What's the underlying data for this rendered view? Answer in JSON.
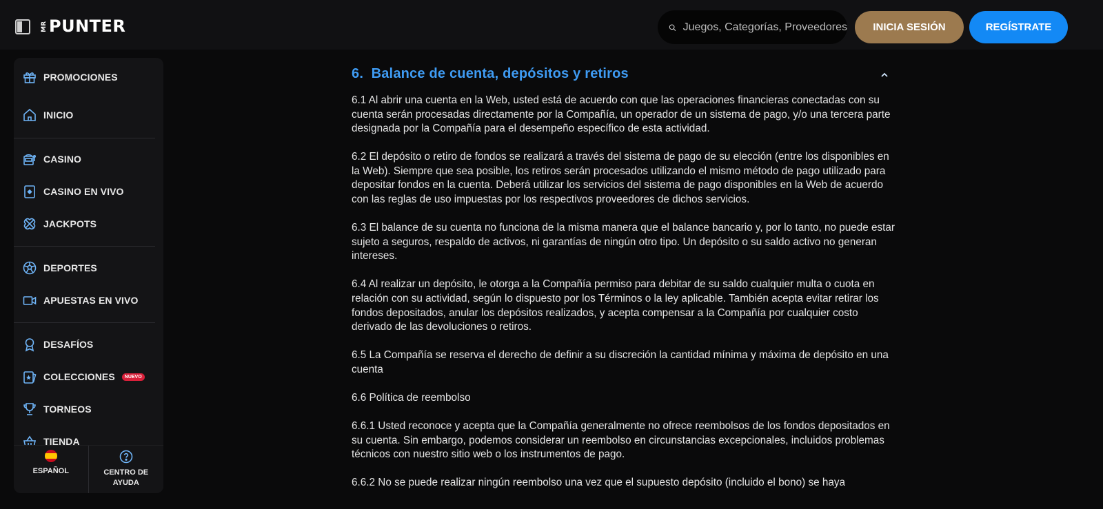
{
  "header": {
    "logo_small": "MR",
    "logo_word": "PUNTER",
    "search_placeholder": "Juegos, Categorías, Proveedores",
    "login_label": "INICIA SESIÓN",
    "register_label": "REGÍSTRATE"
  },
  "sidebar": {
    "items": [
      {
        "label": "PROMOCIONES",
        "icon": "gift-icon"
      },
      {
        "label": "INICIO",
        "icon": "home-icon"
      },
      {
        "label": "CASINO",
        "icon": "slot-machine-icon"
      },
      {
        "label": "CASINO EN VIVO",
        "icon": "card-icon"
      },
      {
        "label": "JACKPOTS",
        "icon": "clover-icon"
      },
      {
        "label": "DEPORTES",
        "icon": "soccer-ball-icon"
      },
      {
        "label": "APUESTAS EN VIVO",
        "icon": "video-camera-icon"
      },
      {
        "label": "DESAFÍOS",
        "icon": "medal-icon"
      },
      {
        "label": "COLECCIONES",
        "icon": "star-card-icon",
        "badge": "NUEVO"
      },
      {
        "label": "TORNEOS",
        "icon": "trophy-icon"
      },
      {
        "label": "TIENDA",
        "icon": "shop-basket-icon"
      }
    ],
    "bottom": {
      "language_label": "ESPAÑOL",
      "help_line1": "CENTRO DE",
      "help_line2": "AYUDA"
    }
  },
  "main": {
    "section_title": "6.  Balance de cuenta, depósitos y retiros",
    "paragraphs": [
      "6.1 Al abrir una cuenta en la Web, usted está de acuerdo con que las operaciones financieras conectadas con su cuenta serán procesadas directamente por la Compañía, un operador de un sistema de pago, y/o una tercera parte designada por la Compañía para el desempeño específico de esta actividad.",
      "6.2 El depósito o retiro de fondos se realizará a través del sistema de pago de su elección (entre los disponibles en la Web). Siempre que sea posible, los retiros serán procesados utilizando el mismo método de pago utilizado para depositar fondos en la cuenta. Deberá utilizar los servicios del sistema de pago disponibles en la Web de acuerdo con las reglas de uso impuestas por los respectivos proveedores de dichos servicios.",
      "6.3 El balance de su cuenta no funciona de la misma manera que el balance bancario y, por lo tanto, no puede estar sujeto a seguros, respaldo de activos, ni garantías de ningún otro tipo. Un depósito o su saldo activo no generan intereses.",
      "6.4 Al realizar un depósito, le otorga a la Compañía permiso para debitar de su saldo cualquier multa o cuota en relación con su actividad, según lo dispuesto por los Términos o la ley aplicable. También acepta evitar retirar los fondos depositados, anular los depósitos realizados, y acepta compensar a la Compañía por cualquier costo derivado de las devoluciones o retiros.",
      "6.5 La Compañía se reserva el derecho de definir a su discreción la cantidad mínima y máxima de depósito en una cuenta",
      "6.6 Política de reembolso",
      "6.6.1 Usted reconoce y acepta que la Compañía generalmente no ofrece reembolsos de los fondos depositados en su cuenta. Sin embargo, podemos considerar un reembolso en circunstancias excepcionales, incluidos problemas técnicos con nuestro sitio web o los instrumentos de pago.",
      "6.6.2 No se puede realizar ningún reembolso una vez que el supuesto depósito (incluido el bono) se haya"
    ]
  },
  "colors": {
    "accent_blue": "#3f9cf4",
    "login_gold": "#9c7a4f",
    "register_blue": "#1389f5",
    "icon_blue": "#6fb4f7"
  }
}
